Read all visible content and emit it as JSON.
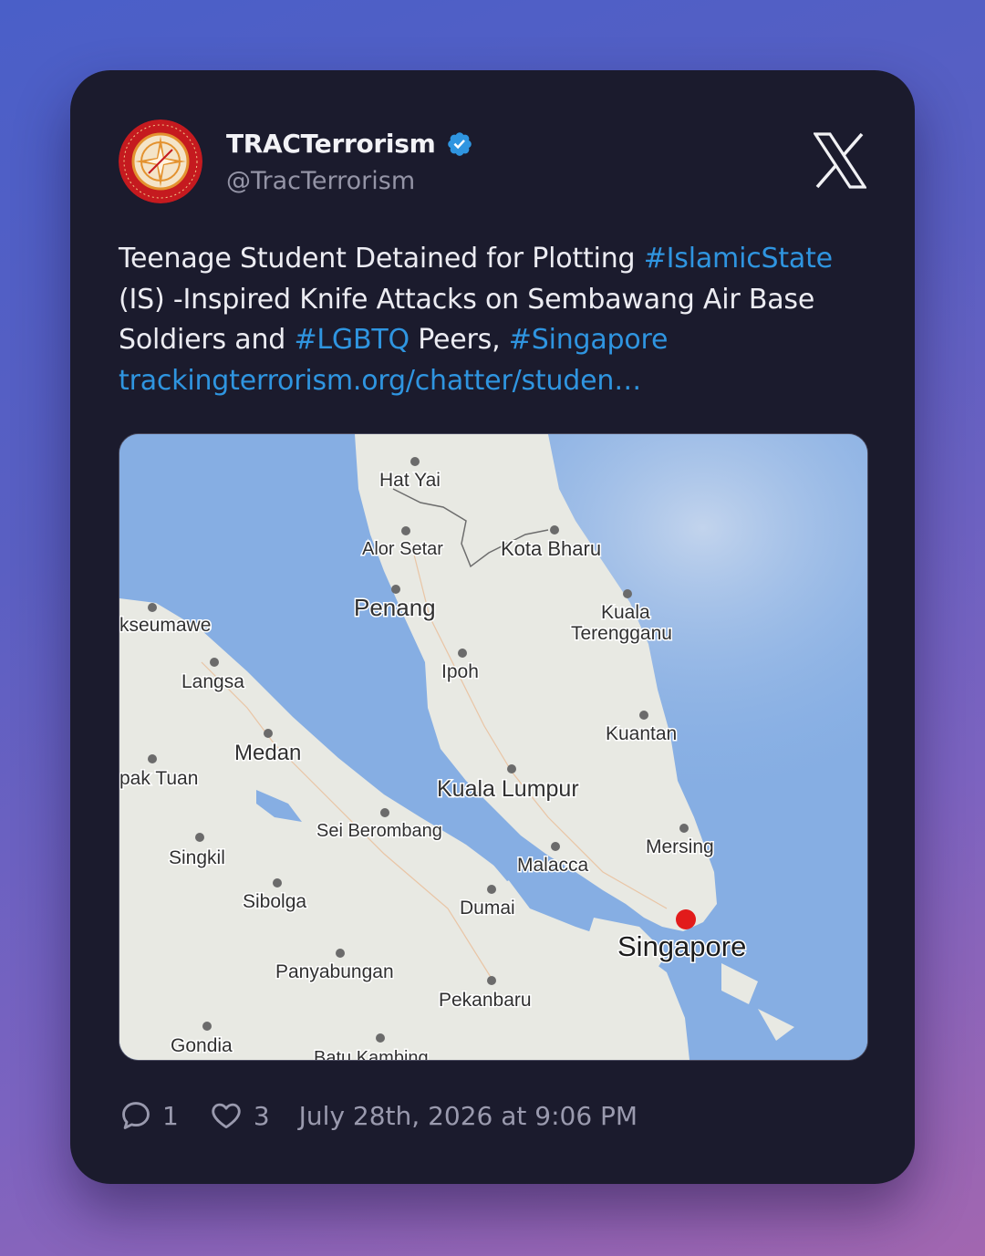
{
  "author": {
    "name": "TRACTerrorism",
    "handle": "@TracTerrorism",
    "avatar_ring_text": "TERRORISM RESEARCH & ANALYSIS CONSORTIUM"
  },
  "post": {
    "text_1": "Teenage Student Detained for Plotting ",
    "tag_1": "#IslamicState",
    "text_2": " (IS) -Inspired Knife Attacks on Sembawang Air Base Soldiers and ",
    "tag_2": "#LGBTQ",
    "text_3": " Peers, ",
    "tag_3": "#Singapore",
    "link": "trackingterrorism.org/chatter/studen…"
  },
  "map": {
    "labels": [
      {
        "id": "hat-yai",
        "text": "Hat Yai"
      },
      {
        "id": "alor-setar",
        "text": "Alor Setar"
      },
      {
        "id": "kota-bharu",
        "text": "Kota Bharu"
      },
      {
        "id": "penang",
        "text": "Penang"
      },
      {
        "id": "kuala",
        "text": "Kuala"
      },
      {
        "id": "terengganu",
        "text": "Terengganu"
      },
      {
        "id": "lhokseumawe",
        "text": "kseumawe"
      },
      {
        "id": "langsa",
        "text": "Langsa"
      },
      {
        "id": "ipoh",
        "text": "Ipoh"
      },
      {
        "id": "medan",
        "text": "Medan"
      },
      {
        "id": "kuantan",
        "text": "Kuantan"
      },
      {
        "id": "tapak-tuan",
        "text": "pak Tuan"
      },
      {
        "id": "kuala-lumpur",
        "text": "Kuala Lumpur"
      },
      {
        "id": "sei-berombang",
        "text": "Sei Berombang"
      },
      {
        "id": "mersing",
        "text": "Mersing"
      },
      {
        "id": "singkil",
        "text": "Singkil"
      },
      {
        "id": "malacca",
        "text": "Malacca"
      },
      {
        "id": "sibolga",
        "text": "Sibolga"
      },
      {
        "id": "dumai",
        "text": "Dumai"
      },
      {
        "id": "singapore",
        "text": "Singapore"
      },
      {
        "id": "panyabungan",
        "text": "Panyabungan"
      },
      {
        "id": "pekanbaru",
        "text": "Pekanbaru"
      },
      {
        "id": "gondia",
        "text": "Gondia"
      },
      {
        "id": "batu-kambing",
        "text": "Batu Kambing"
      }
    ],
    "marker_color": "#e21b1b",
    "land_color": "#e8e9e3",
    "water_color": "#86aee3"
  },
  "footer": {
    "replies": "1",
    "likes": "3",
    "timestamp": "July 28th, 2026 at 9:06 PM"
  },
  "colors": {
    "accent": "#2f95e0",
    "card": "#1b1b2d"
  }
}
